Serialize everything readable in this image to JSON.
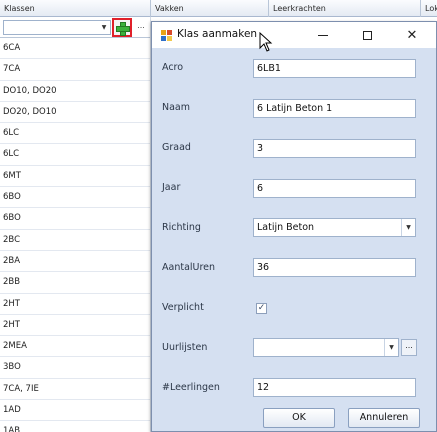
{
  "grid": {
    "columns": [
      "Klassen",
      "Vakken",
      "Leerkrachten",
      "Lok"
    ],
    "rows": [
      "6CA",
      "7CA",
      "DO10, DO20",
      "DO20, DO10",
      "6LC",
      "6LC",
      "6MT",
      "6BO",
      "6BO",
      "2BC",
      "2BA",
      "2BB",
      "2HT",
      "2HT",
      "2MEA",
      "3BO",
      "7CA, 7IE",
      "1AD",
      "1AB"
    ],
    "more_label": "..."
  },
  "dialog": {
    "title": "Klas aanmaken",
    "fields": {
      "acro": {
        "label": "Acro",
        "value": "6LB1"
      },
      "naam": {
        "label": "Naam",
        "value": "6 Latijn Beton 1"
      },
      "graad": {
        "label": "Graad",
        "value": "3"
      },
      "jaar": {
        "label": "Jaar",
        "value": "6"
      },
      "richting": {
        "label": "Richting",
        "value": "Latijn Beton"
      },
      "aantaluren": {
        "label": "AantalUren",
        "value": "36"
      },
      "verplicht": {
        "label": "Verplicht",
        "checked": true,
        "mark": "✓"
      },
      "uurlijsten": {
        "label": "Uurlijsten",
        "value": "",
        "more_label": "..."
      },
      "leerlingen": {
        "label": "#Leerlingen",
        "value": "12"
      }
    },
    "ok_label": "OK",
    "cancel_label": "Annuleren"
  },
  "colors": {
    "dialog_bg": "#d5e0f1",
    "highlight_border": "#e0202a",
    "add_icon": "#3cb13c"
  },
  "icons": [
    "add-icon",
    "app-icon",
    "minimize-icon",
    "maximize-icon",
    "close-icon",
    "mouse-cursor-icon",
    "chevron-down-icon",
    "checkmark-icon"
  ]
}
